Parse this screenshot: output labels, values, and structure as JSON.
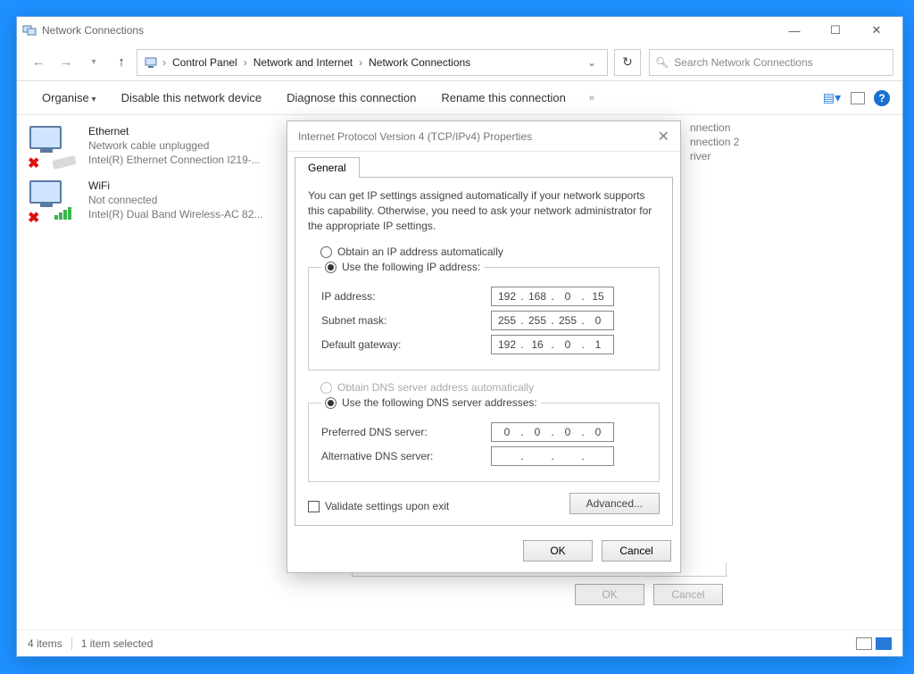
{
  "window": {
    "title": "Network Connections"
  },
  "nav": {
    "refresh_tooltip": "Refresh"
  },
  "breadcrumbs": [
    "Control Panel",
    "Network and Internet",
    "Network Connections"
  ],
  "search": {
    "placeholder": "Search Network Connections"
  },
  "cmdbar": {
    "organise": "Organise",
    "disable": "Disable this network device",
    "diagnose": "Diagnose this connection",
    "rename": "Rename this connection"
  },
  "adapters": [
    {
      "name": "Ethernet",
      "status": "Network cable unplugged",
      "device": "Intel(R) Ethernet Connection I219-...",
      "kind": "wired"
    },
    {
      "name": "WiFi",
      "status": "Not connected",
      "device": "Intel(R) Dual Band Wireless-AC 82...",
      "kind": "wifi"
    }
  ],
  "ghost_adapter": {
    "line1": "nnection",
    "line2": "nnection 2",
    "line3": "river"
  },
  "statusbar": {
    "items": "4 items",
    "selected": "1 item selected"
  },
  "dialog": {
    "title": "Internet Protocol Version 4 (TCP/IPv4) Properties",
    "tab": "General",
    "description": "You can get IP settings assigned automatically if your network supports this capability. Otherwise, you need to ask your network administrator for the appropriate IP settings.",
    "radios": {
      "auto_ip": "Obtain an IP address automatically",
      "manual_ip": "Use the following IP address:",
      "auto_dns": "Obtain DNS server address automatically",
      "manual_dns": "Use the following DNS server addresses:"
    },
    "fields": {
      "ip_label": "IP address:",
      "ip": [
        "192",
        "168",
        "0",
        "15"
      ],
      "mask_label": "Subnet mask:",
      "mask": [
        "255",
        "255",
        "255",
        "0"
      ],
      "gw_label": "Default gateway:",
      "gw": [
        "192",
        "16",
        "0",
        "1"
      ],
      "dns1_label": "Preferred DNS server:",
      "dns1": [
        "0",
        "0",
        "0",
        "0"
      ],
      "dns2_label": "Alternative DNS server:",
      "dns2": [
        "",
        "",
        "",
        ""
      ]
    },
    "validate": "Validate settings upon exit",
    "advanced": "Advanced...",
    "ok": "OK",
    "cancel": "Cancel"
  },
  "under_dialog": {
    "ok": "OK",
    "cancel": "Cancel"
  }
}
